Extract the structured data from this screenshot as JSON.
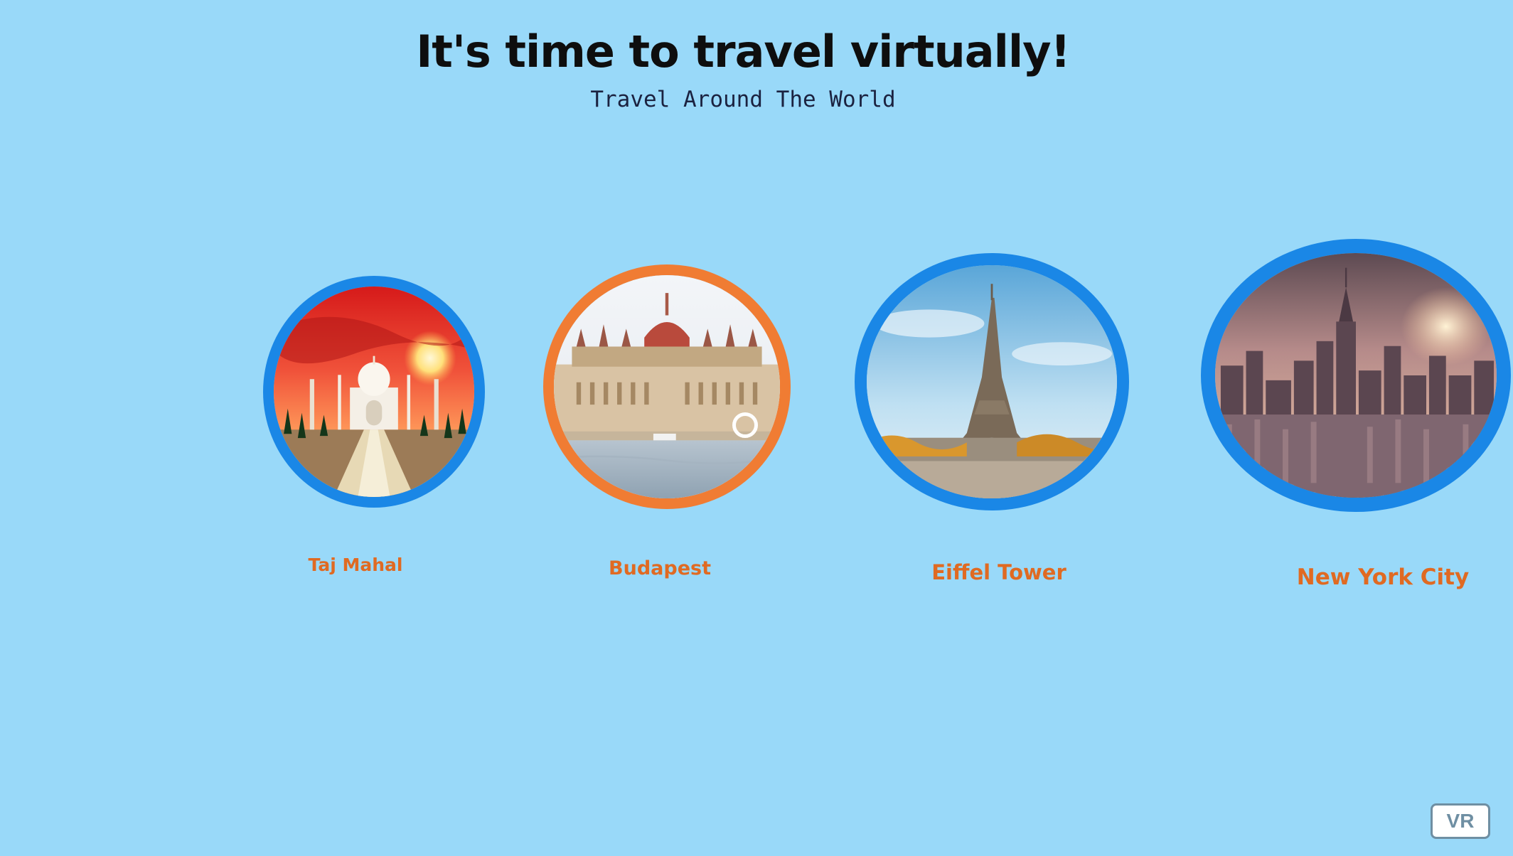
{
  "header": {
    "title": "It's time to travel virtually!",
    "subtitle": "Travel Around The World"
  },
  "destinations": [
    {
      "label": "Taj Mahal",
      "image": "taj-mahal-sunset",
      "ring_color": "#1a87e6",
      "selected": false
    },
    {
      "label": "Budapest",
      "image": "budapest-parliament",
      "ring_color": "#f07c33",
      "selected": true
    },
    {
      "label": "Eiffel Tower",
      "image": "eiffel-tower",
      "ring_color": "#1a87e6",
      "selected": false
    },
    {
      "label": "New York City",
      "image": "new-york-skyline",
      "ring_color": "#1a87e6",
      "selected": false
    }
  ],
  "controls": {
    "vr_label": "VR"
  },
  "colors": {
    "background": "#99d9f9",
    "label_text": "#e06a22",
    "ring_default": "#1a87e6",
    "ring_selected": "#f07c33"
  }
}
